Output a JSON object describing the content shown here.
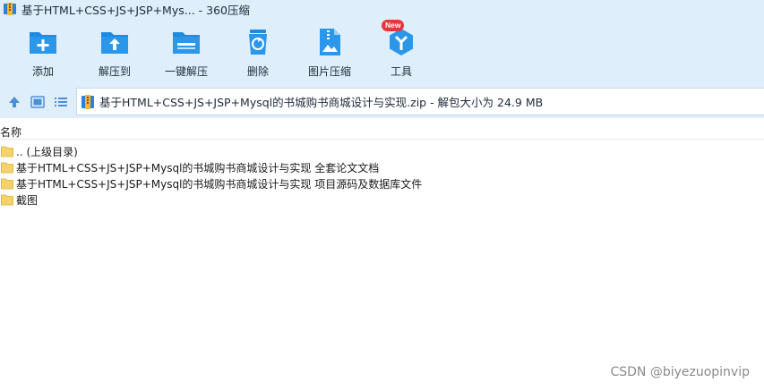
{
  "window": {
    "title": "基于HTML+CSS+JS+JSP+Mys... - 360压缩",
    "app_icon": "zip-archive-icon"
  },
  "toolbar": {
    "items": [
      {
        "label": "添加",
        "icon": "add-icon"
      },
      {
        "label": "解压到",
        "icon": "extract-to-icon"
      },
      {
        "label": "一键解压",
        "icon": "one-click-extract-icon"
      },
      {
        "label": "删除",
        "icon": "delete-icon"
      },
      {
        "label": "图片压缩",
        "icon": "image-compress-icon"
      },
      {
        "label": "工具",
        "icon": "tools-icon",
        "badge": "New"
      }
    ]
  },
  "address": {
    "path": "基于HTML+CSS+JS+JSP+Mysql的书城购书商城设计与实现.zip - 解包大小为 24.9 MB"
  },
  "list": {
    "column_name": "名称",
    "items": [
      {
        "name": ".. (上级目录)"
      },
      {
        "name": "基于HTML+CSS+JS+JSP+Mysql的书城购书商城设计与实现 全套论文文档"
      },
      {
        "name": "基于HTML+CSS+JS+JSP+Mysql的书城购书商城设计与实现 项目源码及数据库文件"
      },
      {
        "name": "截图"
      }
    ]
  },
  "watermark": "CSDN @biyezuopinvip",
  "colors": {
    "toolbar_bg": "#dfeefb",
    "icon_blue": "#1e8ae0",
    "badge_red": "#e8353b",
    "folder_yellow": "#f6d36a"
  }
}
